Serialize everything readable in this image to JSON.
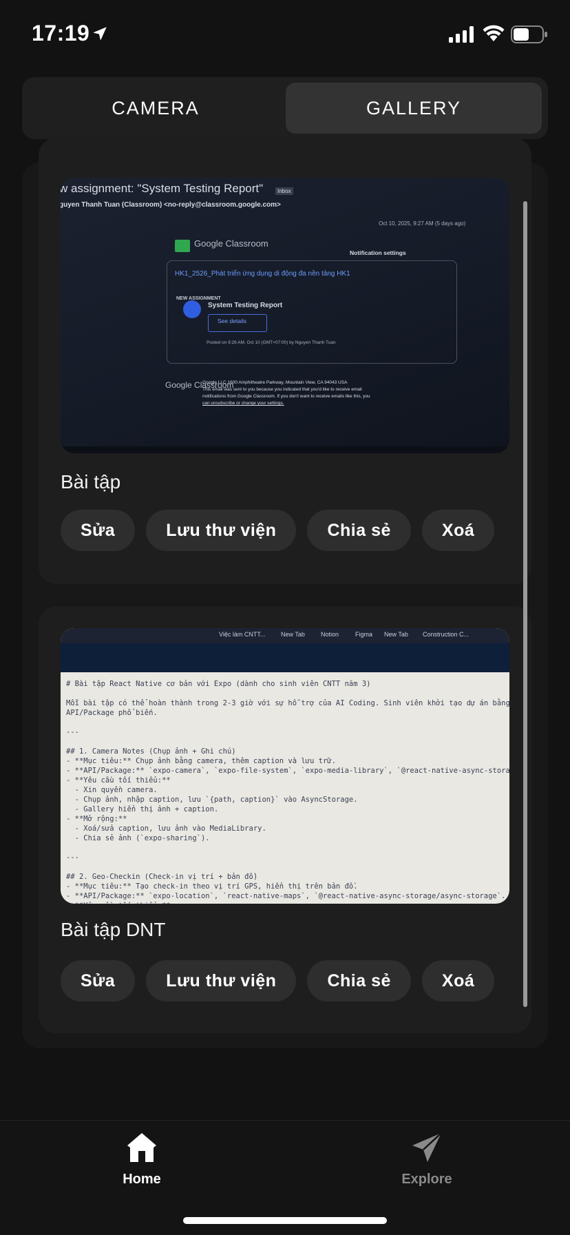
{
  "status_bar": {
    "time": "17:19"
  },
  "segment": {
    "camera": "CAMERA",
    "gallery": "GALLERY",
    "selected": "GALLERY"
  },
  "gallery": [
    {
      "caption": "Bài tập",
      "actions": [
        "Sửa",
        "Lưu thư viện",
        "Chia sẻ",
        "Xoá"
      ],
      "photo": {
        "subject": "w assignment: \"System Testing Report\"",
        "inbox": "Inbox",
        "sender": "guyen Thanh Tuan (Classroom) <no-reply@classroom.google.com>",
        "date": "Oct 10, 2025, 9:27 AM (5 days ago)",
        "brand": "Google Classroom",
        "notif": "Notification settings",
        "course": "HK1_2526_Phát triển ứng dụng di động đa nền tảng HK1",
        "new_assignment": "NEW ASSIGNMENT",
        "assignment": "System Testing Report",
        "see_details": "See details",
        "posted": "Posted on 9:26 AM, Oct 10 (GMT+07:00) by Nguyen Thanh Tuan",
        "footer1": "Google LLC 1600 Amphitheatre Parkway, Mountain View, CA 94043 USA",
        "footer2": "This email was sent to you because you indicated that you'd like to receive email",
        "footer3": "notifications from Google Classroom. If you don't want to receive emails like this, you",
        "footer4": "can unsubscribe or change your settings."
      }
    },
    {
      "caption": "Bài tập DNT",
      "actions": [
        "Sửa",
        "Lưu thư viện",
        "Chia sẻ",
        "Xoá"
      ],
      "photo": {
        "tabs": [
          "Việc làm CNTT...",
          "New Tab",
          "Notion",
          "Figma",
          "New Tab",
          "Construction C..."
        ],
        "lines": "# Bài tập React Native cơ bản với Expo (dành cho sinh viên CNTT năm 3)\n\nMỗi bài tập có thể hoàn thành trong 2-3 giờ với sự hỗ trợ của AI Coding. Sinh viên khởi tạo dự án bằng\nAPI/Package phổ biến.\n\n---\n\n## 1. Camera Notes (Chụp ảnh + Ghi chú)\n- **Mục tiêu:** Chụp ảnh bằng camera, thêm caption và lưu trữ.\n- **API/Package:** `expo-camera`, `expo-file-system`, `expo-media-library`, `@react-native-async-storag\n- **Yêu cầu tối thiểu:**\n  - Xin quyền camera.\n  - Chụp ảnh, nhập caption, lưu `{path, caption}` vào AsyncStorage.\n  - Gallery hiển thị ảnh + caption.\n- **Mở rộng:**\n  - Xoá/sửa caption, lưu ảnh vào MediaLibrary.\n  - Chia sẻ ảnh (`expo-sharing`).\n\n---\n\n## 2. Geo-Checkin (Check-in vị trí + bản đồ)\n- **Mục tiêu:** Tạo check-in theo vị trí GPS, hiển thị trên bản đồ.\n- **API/Package:** `expo-location`, `react-native-maps`, `@react-native-async-storage/async-storage`.\n- **Yêu cầu tối thiểu:**\n  - Xin quyền location.\n  - Nút \"Check-in\" → lưu `{lat, lng, note, time}` vào AsyncStorage.\n  - Màn hình Map hiển thị markers."
      }
    }
  ],
  "tabs": {
    "home": "Home",
    "explore": "Explore",
    "active": "Home"
  }
}
